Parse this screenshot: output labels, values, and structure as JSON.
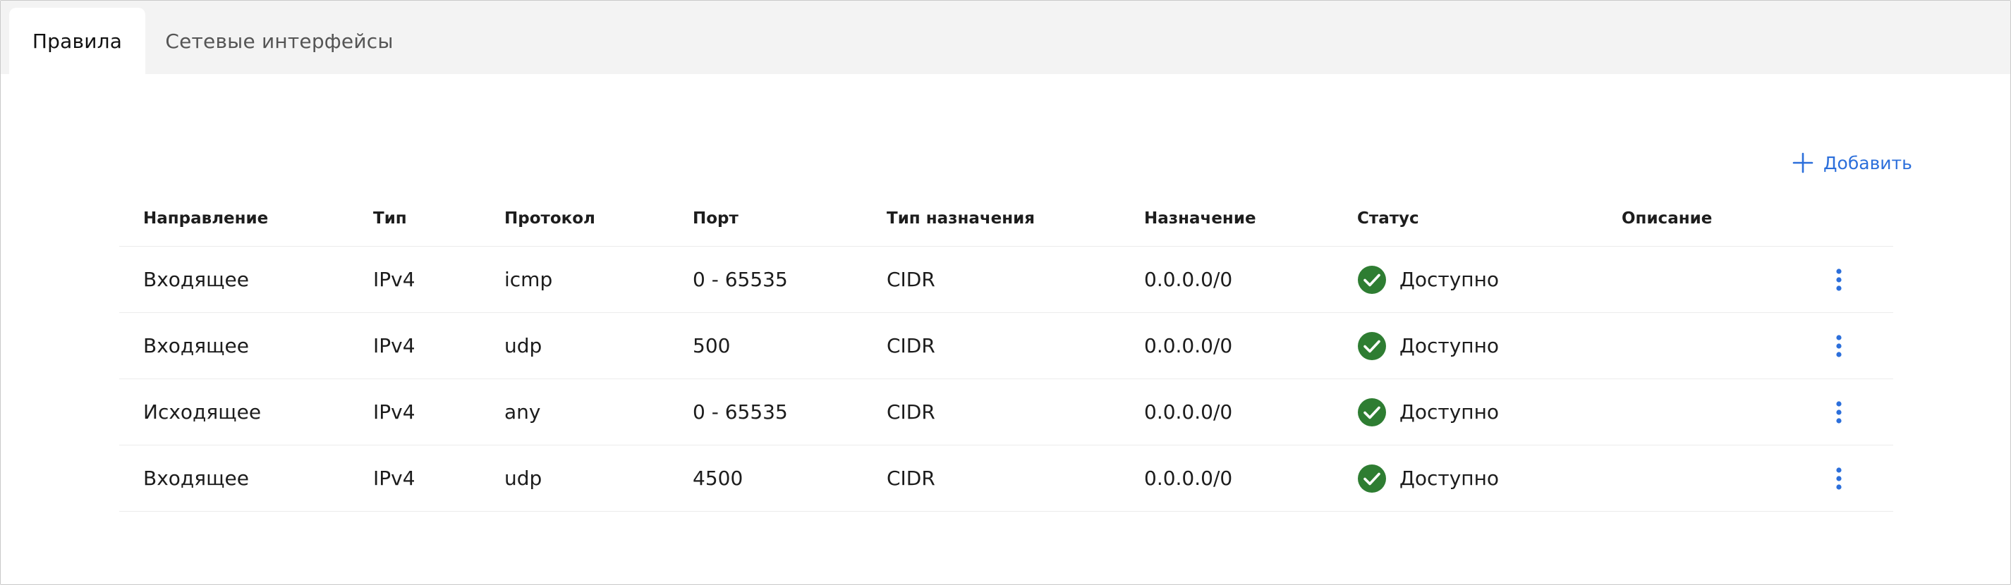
{
  "tabs": [
    {
      "label": "Правила",
      "active": true
    },
    {
      "label": "Сетевые интерфейсы",
      "active": false
    }
  ],
  "toolbar": {
    "add_label": "Добавить",
    "add_icon": "plus-icon",
    "accent_color": "#2c6fdb"
  },
  "table": {
    "columns": [
      "Направление",
      "Тип",
      "Протокол",
      "Порт",
      "Тип назначения",
      "Назначение",
      "Статус",
      "Описание"
    ],
    "rows": [
      {
        "direction": "Входящее",
        "type": "IPv4",
        "protocol": "icmp",
        "port": "0 - 65535",
        "dest_type": "CIDR",
        "destination": "0.0.0.0/0",
        "status": "Доступно",
        "description": ""
      },
      {
        "direction": "Входящее",
        "type": "IPv4",
        "protocol": "udp",
        "port": "500",
        "dest_type": "CIDR",
        "destination": "0.0.0.0/0",
        "status": "Доступно",
        "description": ""
      },
      {
        "direction": "Исходящее",
        "type": "IPv4",
        "protocol": "any",
        "port": "0 - 65535",
        "dest_type": "CIDR",
        "destination": "0.0.0.0/0",
        "status": "Доступно",
        "description": ""
      },
      {
        "direction": "Входящее",
        "type": "IPv4",
        "protocol": "udp",
        "port": "4500",
        "dest_type": "CIDR",
        "destination": "0.0.0.0/0",
        "status": "Доступно",
        "description": ""
      }
    ],
    "status_icon": "check-circle-icon",
    "status_color": "#2e7d32",
    "row_action_icon": "more-vertical-icon"
  }
}
